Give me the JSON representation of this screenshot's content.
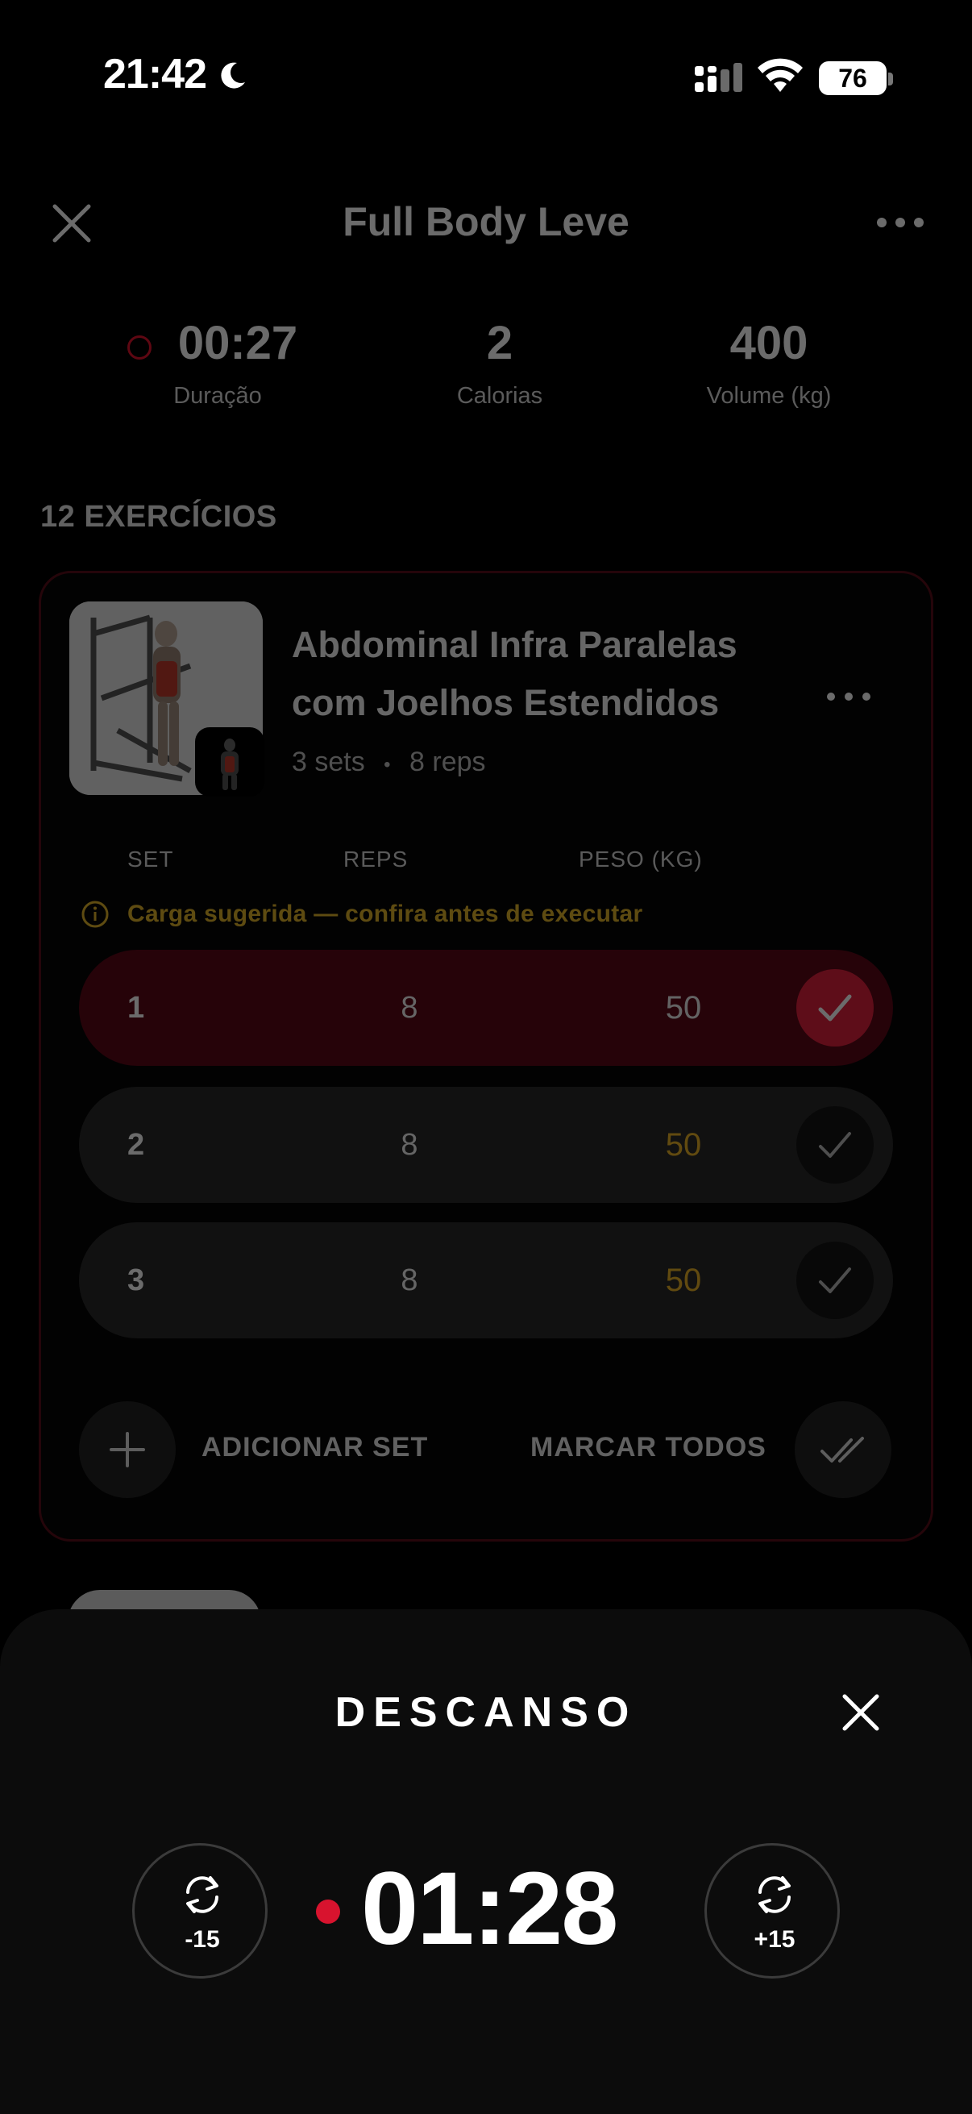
{
  "status_bar": {
    "time": "21:42",
    "battery": "76"
  },
  "header": {
    "title": "Full Body Leve"
  },
  "stats": [
    {
      "value": "00:27",
      "label": "Duração"
    },
    {
      "value": "2",
      "label": "Calorias"
    },
    {
      "value": "400",
      "label": "Volume (kg)"
    }
  ],
  "section_title": "12 EXERCÍCIOS",
  "exercise": {
    "name": "Abdominal Infra Paralelas com Joelhos Estendidos",
    "sets_text": "3 sets",
    "separator": "•",
    "reps_text": "8 reps",
    "columns": {
      "set": "SET",
      "reps": "REPS",
      "weight": "PESO (KG)"
    },
    "warning": "Carga sugerida — confira antes de executar",
    "rows": [
      {
        "set": "1",
        "reps": "8",
        "weight": "50",
        "done": true
      },
      {
        "set": "2",
        "reps": "8",
        "weight": "50",
        "done": false
      },
      {
        "set": "3",
        "reps": "8",
        "weight": "50",
        "done": false
      }
    ],
    "add_set_label": "ADICIONAR SET",
    "mark_all_label": "MARCAR TODOS"
  },
  "rest": {
    "title": "DESCANSO",
    "timer": "01:28",
    "minus_label": "-15",
    "plus_label": "+15"
  },
  "colors": {
    "accent": "#e01f3d",
    "suggested": "#e7b027",
    "done_row": "#5b0817"
  }
}
